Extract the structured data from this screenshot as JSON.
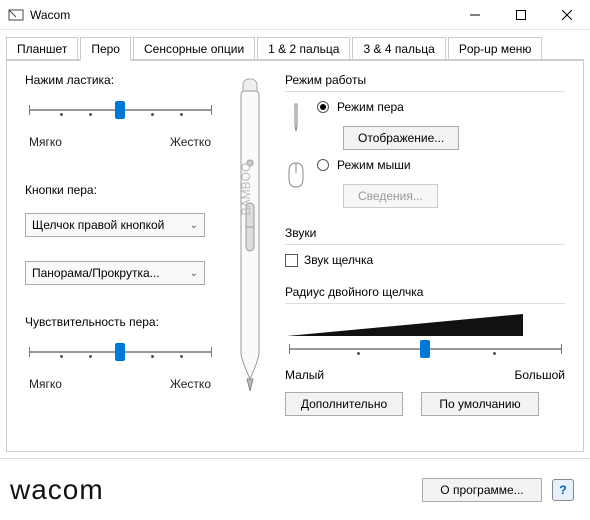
{
  "window": {
    "title": "Wacom"
  },
  "tabs": {
    "items": [
      "Планшет",
      "Перо",
      "Сенсорные опции",
      "1 & 2 пальца",
      "3 & 4 пальца",
      "Pop-up меню"
    ],
    "activeIndex": 1
  },
  "eraser": {
    "title": "Нажим ластика:",
    "min": "Мягко",
    "max": "Жестко"
  },
  "penButtons": {
    "title": "Кнопки пера:",
    "combo1": "Щелчок правой кнопкой",
    "combo2": "Панорама/Прокрутка..."
  },
  "tipFeel": {
    "title": "Чувствительность пера:",
    "min": "Мягко",
    "max": "Жестко"
  },
  "mode": {
    "title": "Режим работы",
    "penMode": "Режим пера",
    "mouseMode": "Режим мыши",
    "mappingBtn": "Отображение...",
    "detailsBtn": "Сведения..."
  },
  "sounds": {
    "title": "Звуки",
    "clickSound": "Звук щелчка"
  },
  "doubleClick": {
    "title": "Радиус двойного щелчка",
    "min": "Малый",
    "max": "Большой"
  },
  "buttons": {
    "advanced": "Дополнительно",
    "defaults": "По умолчанию",
    "about": "О программе..."
  },
  "footer": {
    "logo": "wacom"
  }
}
